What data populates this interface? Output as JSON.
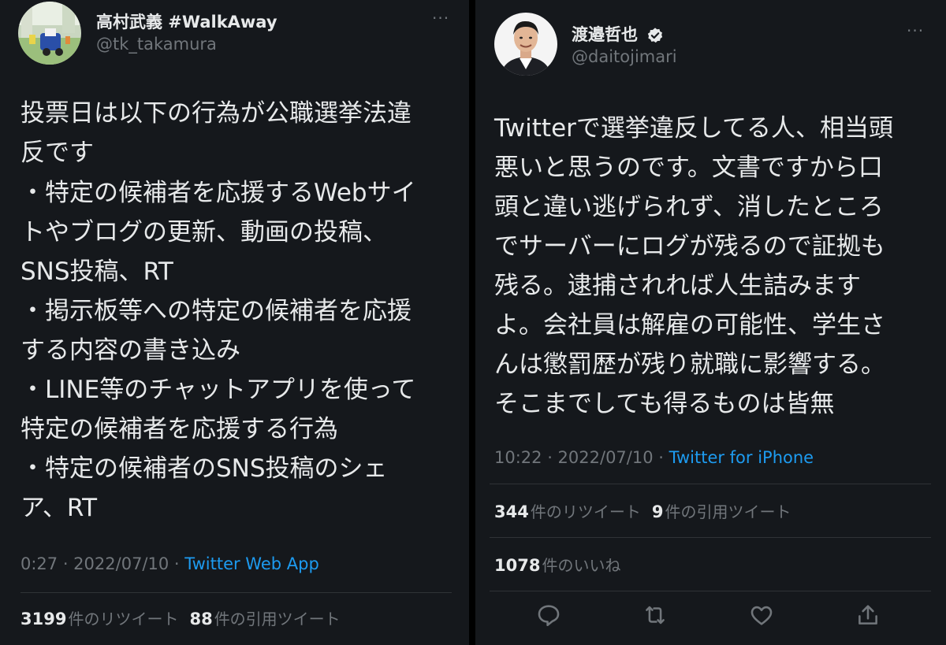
{
  "left_tweet": {
    "name": "高村武義 #WalkAway",
    "handle": "@tk_takamura",
    "body_lines": [
      "投票日は以下の行為が公職選挙法違",
      "反です",
      "・特定の候補者を応援するWebサイ",
      "トやブログの更新、動画の投稿、",
      "SNS投稿、RT",
      "・掲示板等への特定の候補者を応援",
      "する内容の書き込み",
      "・LINE等のチャットアプリを使って",
      "特定の候補者を応援する行為",
      "・特定の候補者のSNS投稿のシェ",
      "ア、RT"
    ],
    "time": "0:27 · 2022/07/10 · ",
    "source": "Twitter Web App",
    "retweets_count": "3199",
    "retweets_label": "件のリツイート",
    "quotes_count": "88",
    "quotes_label": "件の引用ツイート",
    "more_icon": "more-icon"
  },
  "right_tweet": {
    "name": "渡邉哲也",
    "verified": true,
    "handle": "@daitojimari",
    "body_lines": [
      "Twitterで選挙違反してる人、相当頭",
      "悪いと思うのです。文書ですから口",
      "頭と違い逃げられず、消したところ",
      "でサーバーにログが残るので証拠も",
      "残る。逮捕されれば人生詰みます",
      "よ。会社員は解雇の可能性、学生さ",
      "んは懲罰歴が残り就職に影響する。",
      "そこまでしても得るものは皆無"
    ],
    "time": "10:22 · 2022/07/10 · ",
    "source": "Twitter for iPhone",
    "retweets_count": "344",
    "retweets_label": "件のリツイート",
    "quotes_count": "9",
    "quotes_label": "件の引用ツイート",
    "likes_count": "1078",
    "likes_label": "件のいいね",
    "actions": [
      "reply-icon",
      "retweet-icon",
      "like-icon",
      "share-icon"
    ]
  },
  "colors": {
    "background": "#15181c",
    "text": "#e7e9ea",
    "secondary": "#71767b",
    "link": "#1d9bf0",
    "divider": "#2f3336"
  }
}
